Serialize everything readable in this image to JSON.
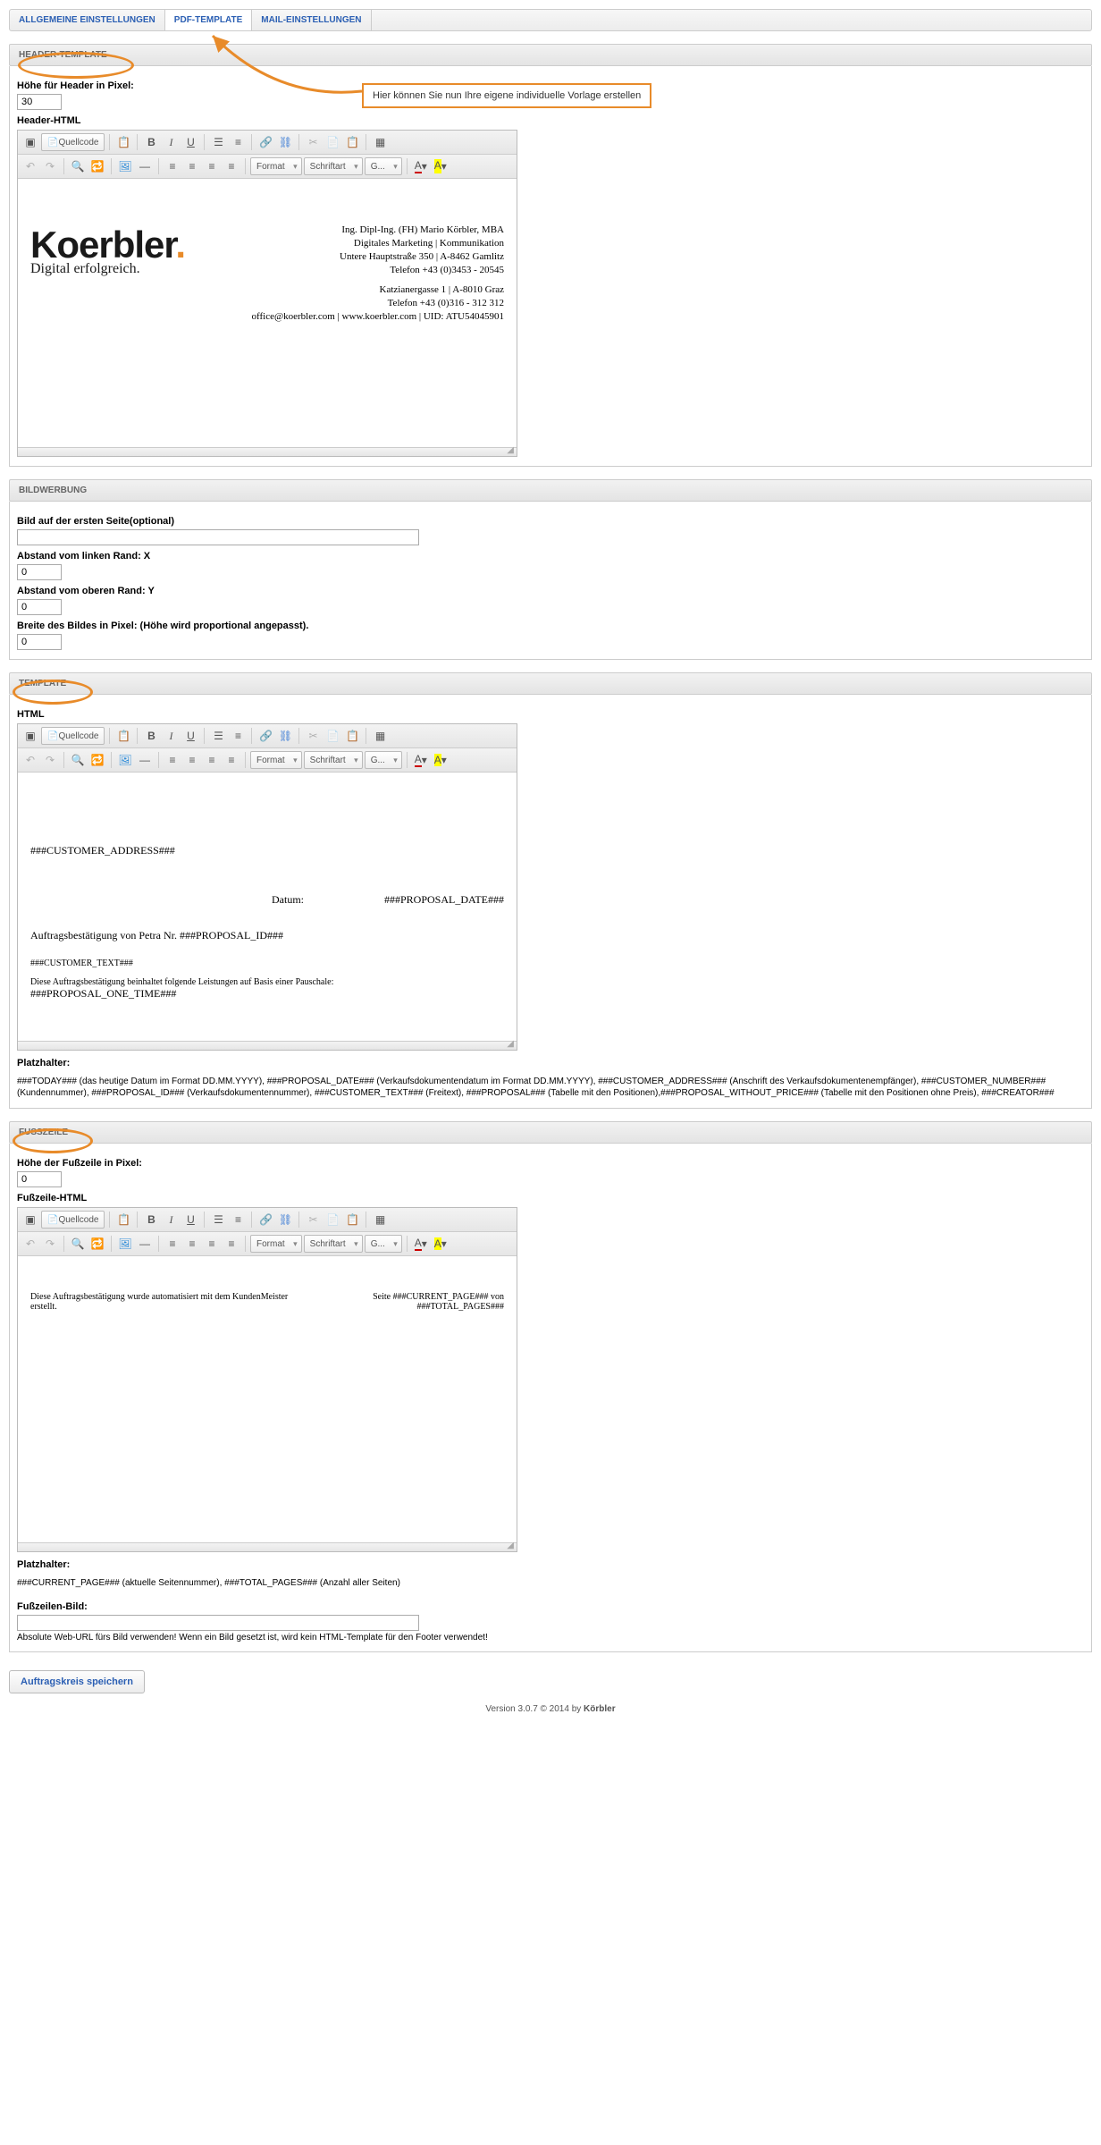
{
  "tabs": {
    "general": "ALLGEMEINE EINSTELLUNGEN",
    "pdf": "PDF-TEMPLATE",
    "mail": "MAIL-EINSTELLUNGEN"
  },
  "callout": "Hier können Sie nun Ihre eigene individuelle Vorlage erstellen",
  "header": {
    "title": "HEADER-TEMPLATE",
    "height_label": "Höhe für Header in Pixel:",
    "height_value": "30",
    "html_label": "Header-HTML",
    "contact1": "Ing. Dipl-Ing. (FH) Mario Körbler, MBA",
    "contact2": "Digitales Marketing | Kommunikation",
    "contact3": "Untere Hauptstraße 350 | A-8462 Gamlitz",
    "contact4": "Telefon +43 (0)3453 - 20545",
    "contact5": "Katzianergasse 1 | A-8010 Graz",
    "contact6": "Telefon +43 (0)316 - 312 312",
    "contact7": "office@koerbler.com | www.koerbler.com | UID: ATU54045901",
    "logo_main": "Koerbler",
    "logo_dot": ".",
    "logo_sub": "Digital erfolgreich."
  },
  "bild": {
    "title": "BILDWERBUNG",
    "first_label": "Bild auf der ersten Seite(optional)",
    "left_label": "Abstand vom linken Rand: X",
    "left_value": "0",
    "top_label": "Abstand vom oberen Rand: Y",
    "top_value": "0",
    "width_label": "Breite des Bildes in Pixel: (Höhe wird proportional angepasst).",
    "width_value": "0"
  },
  "template": {
    "title": "TEMPLATE",
    "html_label": "HTML",
    "body_addr": "###CUSTOMER_ADDRESS###",
    "body_date_lbl": "Datum:",
    "body_date_val": "###PROPOSAL_DATE###",
    "body_subject": "Auftragsbestätigung von Petra Nr. ###PROPOSAL_ID###",
    "body_cust": "###CUSTOMER_TEXT###",
    "body_desc": "Diese Auftragsbestätigung beinhaltet folgende Leistungen auf Basis einer Pauschale:",
    "body_one": "###PROPOSAL_ONE_TIME###",
    "ph_title": "Platzhalter:",
    "ph_text": "###TODAY### (das heutige Datum im Format DD.MM.YYYY), ###PROPOSAL_DATE### (Verkaufsdokumentendatum im Format DD.MM.YYYY), ###CUSTOMER_ADDRESS### (Anschrift des Verkaufsdokumentenempfänger), ###CUSTOMER_NUMBER### (Kundennummer), ###PROPOSAL_ID### (Verkaufsdokumentennummer), ###CUSTOMER_TEXT### (Freitext), ###PROPOSAL### (Tabelle mit den Positionen),###PROPOSAL_WITHOUT_PRICE### (Tabelle mit den Positionen ohne Preis), ###CREATOR###"
  },
  "footer": {
    "title": "FUSSZEILE",
    "height_label": "Höhe der Fußzeile in Pixel:",
    "height_value": "0",
    "html_label": "Fußzeile-HTML",
    "left_text": "Diese Auftragsbestätigung wurde automatisiert mit dem KundenMeister erstellt.",
    "right_text1": "Seite ###CURRENT_PAGE### von",
    "right_text2": "###TOTAL_PAGES###",
    "ph_title": "Platzhalter:",
    "ph_text": "###CURRENT_PAGE### (aktuelle Seitennummer), ###TOTAL_PAGES### (Anzahl aller Seiten)",
    "img_label": "Fußzeilen-Bild:",
    "img_note": "Absolute Web-URL fürs Bild verwenden! Wenn ein Bild gesetzt ist, wird kein HTML-Template für den Footer verwendet!"
  },
  "toolbar": {
    "source": "Quellcode",
    "format": "Format",
    "font": "Schriftart",
    "size": "G..."
  },
  "save": "Auftragskreis speichern",
  "version_pre": "Version 3.0.7 © 2014 by ",
  "version_brand": "Körbler"
}
